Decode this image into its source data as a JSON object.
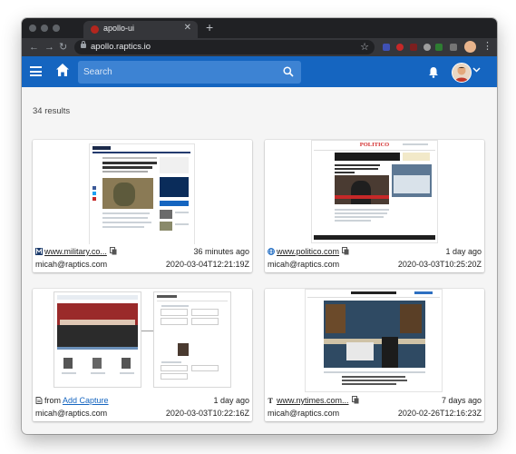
{
  "browser": {
    "tab_title": "apollo-ui",
    "url": "apollo.raptics.io"
  },
  "header": {
    "search_placeholder": "Search"
  },
  "results": {
    "count_label": "34 results",
    "cards": [
      {
        "source_icon": "m-letter-icon",
        "link_text": "www.military.co...",
        "relative_time": "36 minutes ago",
        "user": "micah@raptics.com",
        "timestamp": "2020-03-04T12:21:19Z"
      },
      {
        "source_icon": "globe-icon",
        "link_text": "www.politico.com",
        "relative_time": "1 day ago",
        "user": "micah@raptics.com",
        "timestamp": "2020-03-03T10:25:20Z",
        "thumb_logo": "POLITICO"
      },
      {
        "source_icon": "document-icon",
        "prefix": "from",
        "link_text": "Add Capture",
        "relative_time": "1 day ago",
        "user": "micah@raptics.com",
        "timestamp": "2020-03-03T10:22:16Z"
      },
      {
        "source_icon": "nyt-icon",
        "link_text": "www.nytimes.com...",
        "relative_time": "7 days ago",
        "user": "micah@raptics.com",
        "timestamp": "2020-02-26T12:16:23Z"
      }
    ]
  },
  "colors": {
    "appbar": "#1565c0",
    "search_bg": "#3d83d3",
    "link_blue": "#1565c0",
    "browser_chrome": "#202124"
  }
}
